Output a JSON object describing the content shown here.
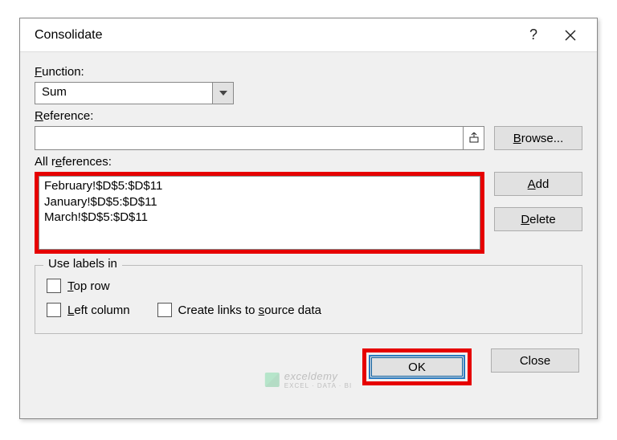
{
  "titlebar": {
    "title": "Consolidate",
    "help": "?",
    "close": "×"
  },
  "labels": {
    "function": "Function:",
    "reference": "Reference:",
    "all_references": "All references:",
    "use_labels_in": "Use labels in",
    "top_row": "Top row",
    "left_column": "Left column",
    "create_links": "Create links to source data"
  },
  "function_select": {
    "value": "Sum"
  },
  "reference_input": {
    "value": ""
  },
  "all_refs": [
    "February!$D$5:$D$11",
    "January!$D$5:$D$11",
    "March!$D$5:$D$11"
  ],
  "buttons": {
    "browse": "Browse...",
    "add": "Add",
    "delete": "Delete",
    "ok": "OK",
    "close": "Close"
  },
  "watermark": {
    "main": "exceldemy",
    "sub": "EXCEL · DATA · BI"
  }
}
